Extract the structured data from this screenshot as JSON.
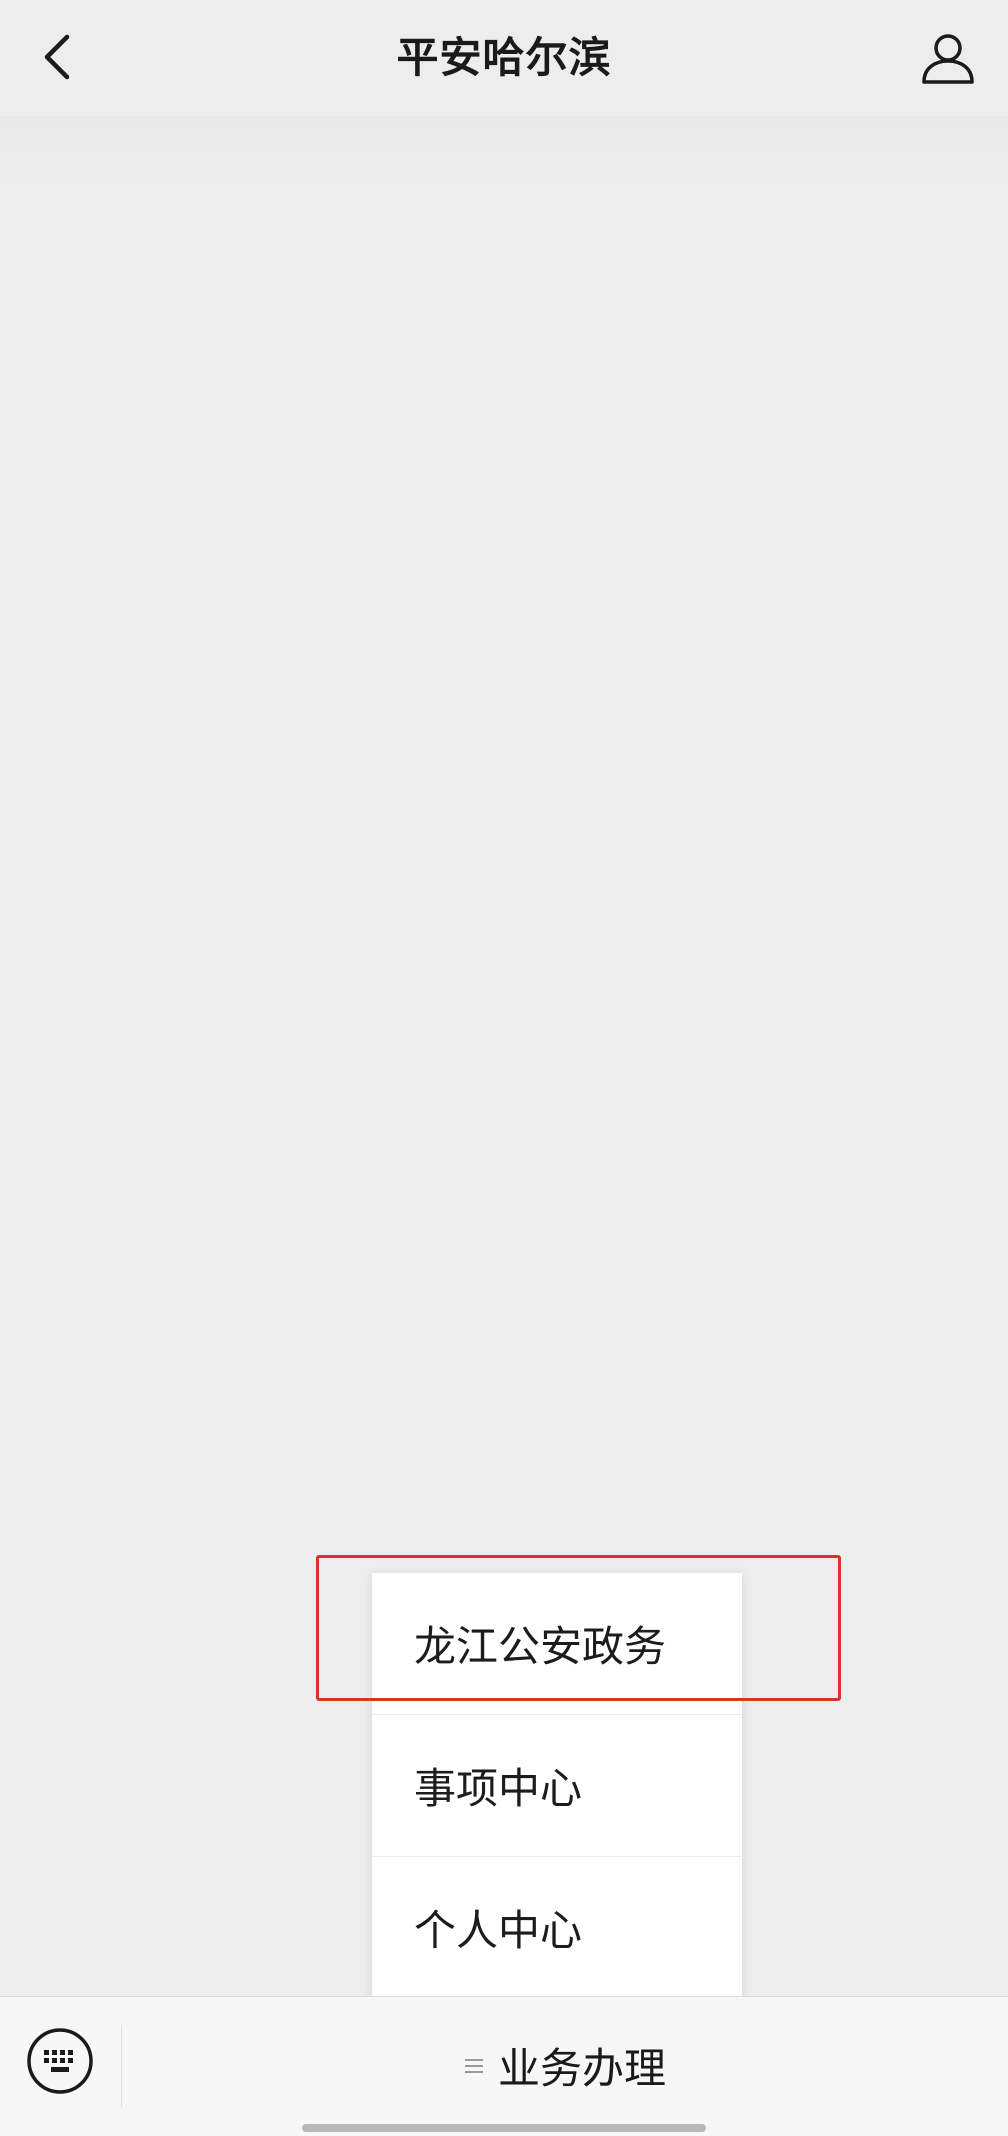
{
  "header": {
    "title": "平安哈尔滨",
    "back_icon": "chevron-left-icon",
    "profile_icon": "user-profile-icon"
  },
  "popup_menu": {
    "items": [
      {
        "label": "龙江公安政务",
        "highlighted": true
      },
      {
        "label": "事项中心",
        "highlighted": false
      },
      {
        "label": "个人中心",
        "highlighted": false
      }
    ],
    "highlight_color": "#e0302a"
  },
  "bottom_bar": {
    "keyboard_icon": "keyboard-icon",
    "menu_icon": "menu-lines-icon",
    "menu_label": "业务办理"
  },
  "colors": {
    "background": "#ededed",
    "bar_background": "#f7f7f7",
    "menu_background": "#ffffff"
  }
}
